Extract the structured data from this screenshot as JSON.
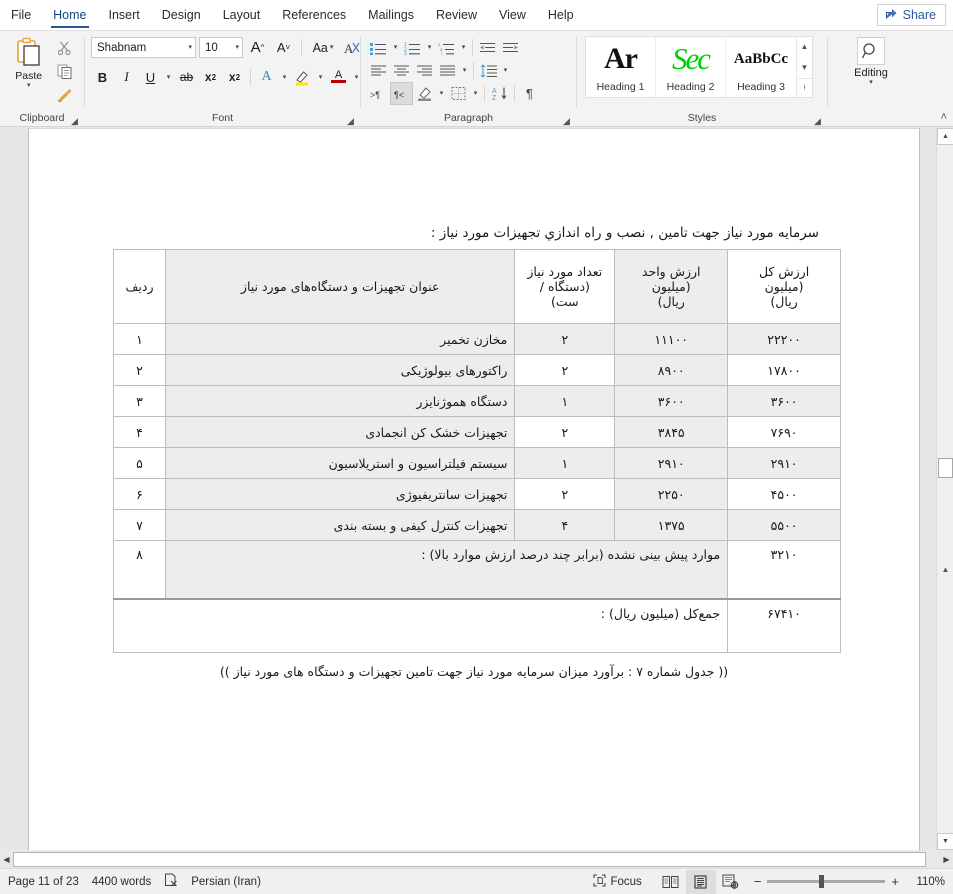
{
  "window": {
    "tabs": [
      {
        "label": "File",
        "active": false
      },
      {
        "label": "Home",
        "active": true
      },
      {
        "label": "Insert",
        "active": false
      },
      {
        "label": "Design",
        "active": false
      },
      {
        "label": "Layout",
        "active": false
      },
      {
        "label": "References",
        "active": false
      },
      {
        "label": "Mailings",
        "active": false
      },
      {
        "label": "Review",
        "active": false
      },
      {
        "label": "View",
        "active": false
      },
      {
        "label": "Help",
        "active": false
      }
    ],
    "share_label": "Share",
    "share_icon": "share-arrow-icon",
    "accent_color": "#2b579a"
  },
  "ribbon": {
    "clipboard": {
      "group_label": "Clipboard",
      "paste_label": "Paste",
      "paste_icon": "clipboard-paste-icon",
      "cut_icon": "scissors-icon",
      "copy_icon": "copy-icon",
      "format_painter_icon": "format-painter-icon",
      "dialog_icon": "dialog-launcher-icon"
    },
    "font": {
      "group_label": "Font",
      "font_name": "Shabnam",
      "font_size": "10",
      "grow_font_icon": "grow-font-icon",
      "shrink_font_icon": "shrink-font-icon",
      "change_case_label": "Aa",
      "clear_formatting_icon": "clear-formatting-icon",
      "bold_label": "B",
      "italic_label": "I",
      "underline_label": "U",
      "strikethrough_label": "ab",
      "subscript_label": "x",
      "superscript_label": "x",
      "text_effects_label": "A",
      "highlight_icon": "text-highlight-icon",
      "font_color_label": "A",
      "dialog_icon": "dialog-launcher-icon"
    },
    "paragraph": {
      "group_label": "Paragraph",
      "bullets_icon": "bullet-list-icon",
      "numbering_icon": "numbered-list-icon",
      "multilevel_icon": "multilevel-list-icon",
      "decrease_indent_icon": "decrease-indent-icon",
      "increase_indent_icon": "increase-indent-icon",
      "align_left_icon": "align-left-icon",
      "align_center_icon": "align-center-icon",
      "align_right_icon": "align-right-icon",
      "justify_icon": "justify-icon",
      "line_spacing_icon": "line-spacing-icon",
      "ltr_icon": "left-to-right-text-icon",
      "rtl_icon": "right-to-left-text-icon",
      "rtl_active": true,
      "shading_icon": "paragraph-shading-icon",
      "borders_icon": "borders-icon",
      "sort_icon": "sort-az-icon",
      "show_marks_icon": "pilcrow-icon",
      "dialog_icon": "dialog-launcher-icon"
    },
    "styles": {
      "group_label": "Styles",
      "items": [
        {
          "name": "Heading 1",
          "preview": "Ar"
        },
        {
          "name": "Heading 2",
          "preview": "Sec"
        },
        {
          "name": "Heading 3",
          "preview": "AaBbCc"
        }
      ],
      "scroll_up_icon": "chevron-up-icon",
      "scroll_down_icon": "chevron-down-icon",
      "more_icon": "styles-more-icon",
      "dialog_icon": "dialog-launcher-icon",
      "heading2_color": "#00d000"
    },
    "editing": {
      "group_label": "Editing",
      "label": "Editing",
      "icon": "magnifier-icon",
      "caret_icon": "chevron-down-icon"
    },
    "collapse_icon": "chevron-up-icon"
  },
  "document": {
    "intro_line": "سرمايه مورد نياز جهت تامين , نصب و راه اندازي تجهيزات مورد نياز :",
    "caption": "(( جدول شماره ۷ : برآورد ميزان سرمايه مورد نياز جهت تامين تجهيزات و دستگاه های مورد نياز ))",
    "table": {
      "headers": [
        "ارزش کل (ميليون ريال)",
        "ارزش واحد (ميليون ريال)",
        "تعداد مورد نياز (دستگاه / ست)",
        "عنوان تجهيزات و دستگاه‌های مورد نياز",
        "رديف"
      ],
      "header_lines": [
        [
          "ارزش کل",
          "(ميليون",
          "ريال)"
        ],
        [
          "ارزش واحد",
          "(ميليون",
          "ريال)"
        ],
        [
          "تعداد مورد نياز",
          "(دستگاه /",
          "ست)"
        ],
        [
          "عنوان تجهيزات و دستگاه‌های مورد نياز"
        ],
        [
          "رديف"
        ]
      ],
      "rows": [
        {
          "radif": "۱",
          "title": "مخازن تخمير",
          "count": "۲",
          "unit": "۱۱۱۰۰",
          "total": "۲۲۲۰۰"
        },
        {
          "radif": "۲",
          "title": "راکتورهای بيولوژيکی",
          "count": "۲",
          "unit": "۸۹۰۰",
          "total": "۱۷۸۰۰"
        },
        {
          "radif": "۳",
          "title": "دستگاه هموژنايزر",
          "count": "۱",
          "unit": "۳۶۰۰",
          "total": "۳۶۰۰"
        },
        {
          "radif": "۴",
          "title": "تجهيزات خشک کن انجمادی",
          "count": "۲",
          "unit": "۳۸۴۵",
          "total": "۷۶۹۰"
        },
        {
          "radif": "۵",
          "title": "سيستم فيلتراسيون و استريلاسيون",
          "count": "۱",
          "unit": "۲۹۱۰",
          "total": "۲۹۱۰"
        },
        {
          "radif": "۶",
          "title": "تجهيزات سانتريفيوژی",
          "count": "۲",
          "unit": "۲۲۵۰",
          "total": "۴۵۰۰"
        },
        {
          "radif": "۷",
          "title": "تجهيزات کنترل کيفی و بسته بندی",
          "count": "۴",
          "unit": "۱۳۷۵",
          "total": "۵۵۰۰"
        }
      ],
      "row8": {
        "radif": "۸",
        "title": "موارد پيش بينی نشده (برابر چند درصد ارزش موارد بالا) :",
        "count": "",
        "unit": "",
        "total": "۳۲۱۰"
      },
      "total_row": {
        "label": "جمع‌کل (ميليون ريال) :",
        "total": "۶۷۴۱۰"
      }
    }
  },
  "statusbar": {
    "page": "Page 11 of 23",
    "words": "4400 words",
    "proofing_icon": "proofing-errors-icon",
    "language": "Persian (Iran)",
    "focus_label": "Focus",
    "focus_icon": "focus-mode-icon",
    "read_mode_icon": "read-mode-icon",
    "print_layout_icon": "print-layout-icon",
    "web_layout_icon": "web-layout-icon",
    "zoom_out_label": "−",
    "zoom_in_label": "+",
    "zoom_level": "110%"
  },
  "scrollbars": {
    "v_up_icon": "scroll-up-icon",
    "v_down_icon": "scroll-down-icon",
    "v_mini_icon": "split-page-icon",
    "h_left_icon": "scroll-left-icon",
    "h_right_icon": "scroll-right-icon"
  }
}
